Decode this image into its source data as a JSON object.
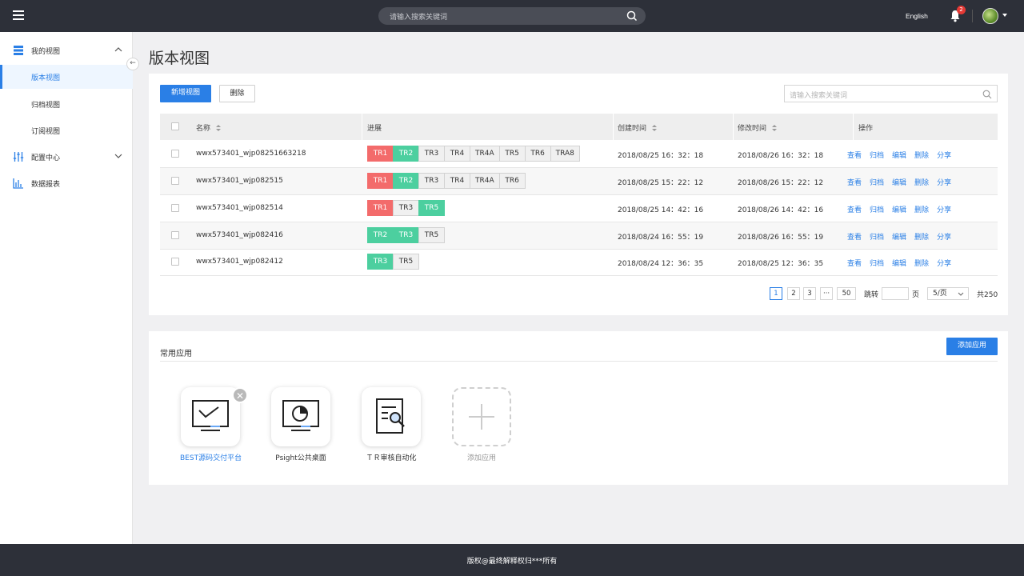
{
  "header": {
    "search_placeholder": "请输入搜索关键词",
    "language": "English",
    "notification_count": "2"
  },
  "sidebar": {
    "items": [
      {
        "label": "我的视图",
        "icon": "list-view-icon"
      },
      {
        "label": "版本视图"
      },
      {
        "label": "归档视图"
      },
      {
        "label": "订阅视图"
      },
      {
        "label": "配置中心",
        "icon": "sliders-icon"
      },
      {
        "label": "数据报表",
        "icon": "bar-chart-icon"
      }
    ],
    "collapse_glyph": "←"
  },
  "page": {
    "title": "版本视图"
  },
  "toolbar": {
    "add_label": "新增视图",
    "delete_label": "删除",
    "search_placeholder": "请输入搜索关键词"
  },
  "table": {
    "columns": [
      "名称",
      "进展",
      "创建时间",
      "修改时间",
      "操作"
    ],
    "rows": [
      {
        "name": "wwx573401_wjp08251663218",
        "tags": [
          {
            "t": "TR1",
            "s": "red"
          },
          {
            "t": "TR2",
            "s": "green"
          },
          {
            "t": "TR3",
            "s": "gray"
          },
          {
            "t": "TR4",
            "s": "gray"
          },
          {
            "t": "TR4A",
            "s": "gray"
          },
          {
            "t": "TR5",
            "s": "gray"
          },
          {
            "t": "TR6",
            "s": "gray"
          },
          {
            "t": "TRA8",
            "s": "gray"
          }
        ],
        "created": "2018/08/25  16：32：18",
        "modified": "2018/08/26  16：32：18"
      },
      {
        "name": "wwx573401_wjp082515",
        "tags": [
          {
            "t": "TR1",
            "s": "red"
          },
          {
            "t": "TR2",
            "s": "green"
          },
          {
            "t": "TR3",
            "s": "gray"
          },
          {
            "t": "TR4",
            "s": "gray"
          },
          {
            "t": "TR4A",
            "s": "gray"
          },
          {
            "t": "TR6",
            "s": "gray"
          }
        ],
        "created": "2018/08/25  15：22：12",
        "modified": "2018/08/26  15：22：12"
      },
      {
        "name": "wwx573401_wjp082514",
        "tags": [
          {
            "t": "TR1",
            "s": "red"
          },
          {
            "t": "TR3",
            "s": "gray"
          },
          {
            "t": "TR5",
            "s": "green"
          }
        ],
        "created": "2018/08/25  14：42：16",
        "modified": "2018/08/26  14：42：16"
      },
      {
        "name": "wwx573401_wjp082416",
        "tags": [
          {
            "t": "TR2",
            "s": "green"
          },
          {
            "t": "TR3",
            "s": "green"
          },
          {
            "t": "TR5",
            "s": "gray"
          }
        ],
        "created": "2018/08/24  16：55：19",
        "modified": "2018/08/26  16：55：19"
      },
      {
        "name": "wwx573401_wjp082412",
        "tags": [
          {
            "t": "TR3",
            "s": "green"
          },
          {
            "t": "TR5",
            "s": "gray"
          }
        ],
        "created": "2018/08/24  12：36：35",
        "modified": "2018/08/25  12：36：35"
      }
    ],
    "actions": [
      "查看",
      "归档",
      "编辑",
      "删除",
      "分享"
    ]
  },
  "pagination": {
    "pages": [
      "1",
      "2",
      "3",
      "···",
      "50"
    ],
    "jump_label": "跳转",
    "page_unit": "页",
    "page_size": "5/页",
    "total": "共250"
  },
  "apps": {
    "title": "常用应用",
    "add_button": "添加应用",
    "remove_glyph": "✕",
    "items": [
      {
        "label": "BEST源码交付平台",
        "icon": "monitor-check-icon"
      },
      {
        "label": "Psight公共桌面",
        "icon": "monitor-pie-chart-icon"
      },
      {
        "label": "ＴＲ审核自动化",
        "icon": "document-search-icon"
      },
      {
        "label": "添加应用",
        "icon": "plus-icon"
      }
    ]
  },
  "footer": {
    "text": "版权@最终解释权归***所有"
  },
  "colors": {
    "primary": "#2a7fe6",
    "tag_red": "#f36b6b",
    "tag_green": "#4ccf9f",
    "topbar": "#2d3039"
  }
}
